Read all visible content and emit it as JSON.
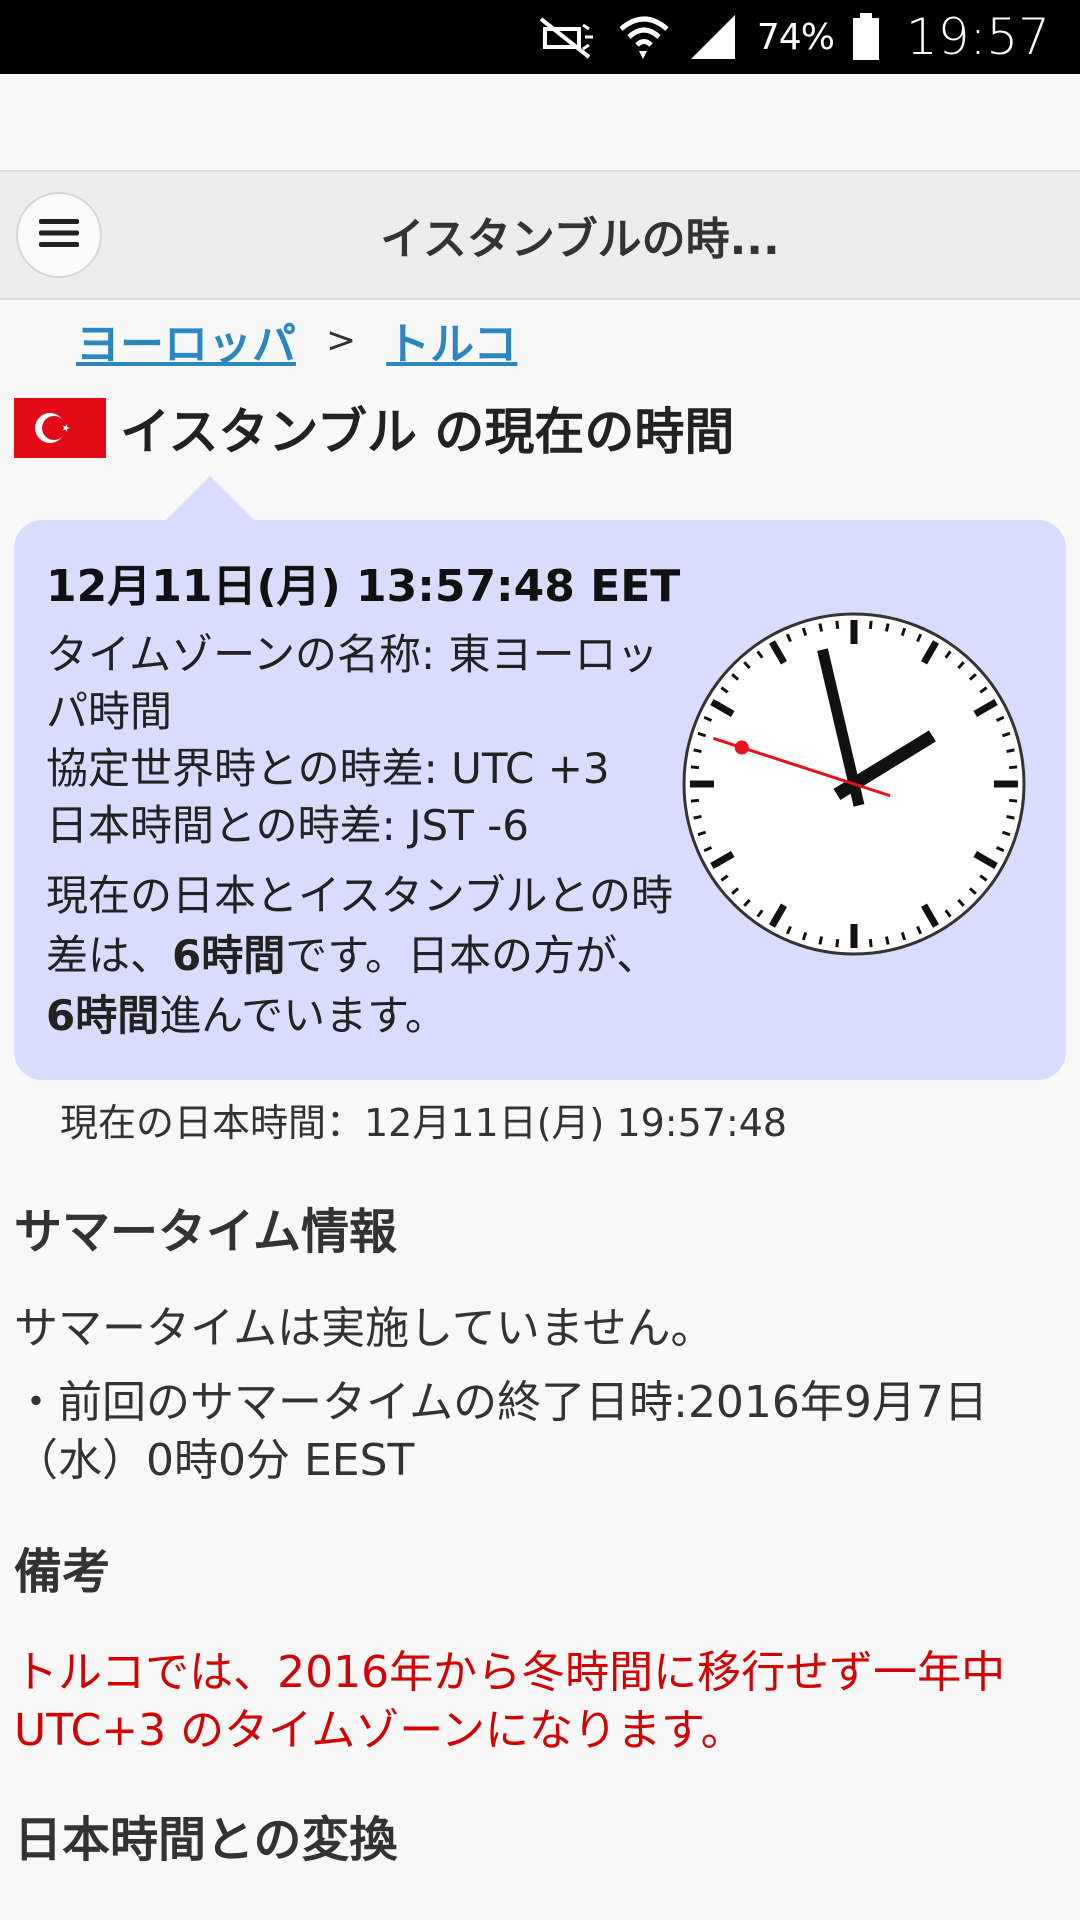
{
  "status_bar": {
    "battery_percent": "74%",
    "time": "19:57",
    "icons": [
      "mute-icon",
      "wifi-icon",
      "cell-signal-icon",
      "battery-icon"
    ]
  },
  "header": {
    "title": "イスタンブルの時...",
    "menu_icon": "hamburger-menu-icon"
  },
  "breadcrumb": {
    "items": [
      "ヨーロッパ",
      "トルコ"
    ],
    "separator": ">"
  },
  "page": {
    "title": "イスタンブル の現在の時間",
    "flag": "turkey-flag"
  },
  "card": {
    "datetime": "12月11日(月) 13:57:48 EET",
    "timezone_line": "タイムゾーンの名称: 東ヨーロッパ時間",
    "utc_line": "協定世界時との時差: UTC +3",
    "jst_line": "日本時間との時差: JST -6",
    "diff_part1": "現在の日本とイスタンブルとの時差は、",
    "diff_hours1": "6時間",
    "diff_part2": "です。日本の方が、",
    "diff_hours2": "6時間",
    "diff_part3": "進んでいます。",
    "clock": {
      "hour": 13,
      "minute": 57,
      "second": 48
    }
  },
  "japan_time": "現在の日本時間：12月11日(月) 19:57:48",
  "summer_time": {
    "heading": "サマータイム情報",
    "status": "サマータイムは実施していません。",
    "last_end": "・前回のサマータイムの終了日時:2016年9月7日（水）0時0分 EEST"
  },
  "notes": {
    "heading": "備考",
    "text": "トルコでは、2016年から冬時間に移行せず一年中UTC+3 のタイムゾーンになります。"
  },
  "conversion": {
    "heading": "日本時間との変換"
  },
  "colors": {
    "card_bg": "#d9dcfd",
    "link": "#2a87c2",
    "warning": "#d40000",
    "flag_red": "#e30a17"
  }
}
